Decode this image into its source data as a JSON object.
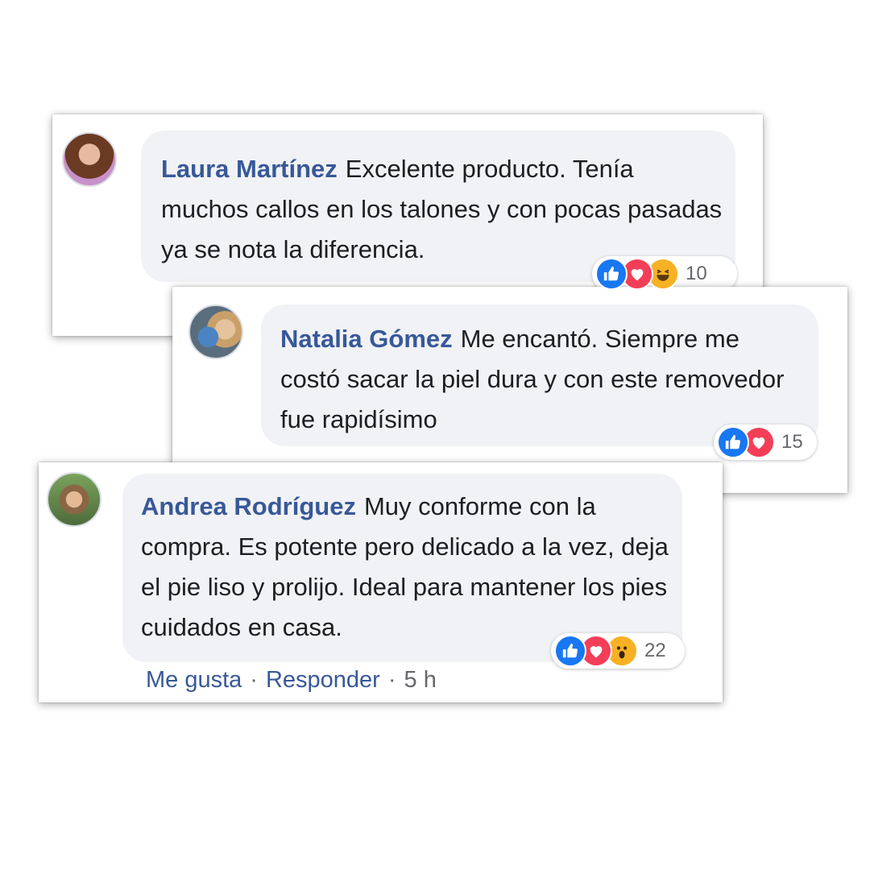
{
  "comments": [
    {
      "name": "Laura Martínez",
      "text": "Excelente producto. Tenía muchos callos en los talones y con pocas pasadas ya se nota la diferencia.",
      "reactions": [
        "like",
        "love",
        "haha"
      ],
      "count": "10"
    },
    {
      "name": "Natalia Gómez",
      "text": "Me encantó. Siempre me costó sacar la piel dura y con este removedor fue rapidísimo",
      "reactions": [
        "like",
        "love"
      ],
      "count": "15"
    },
    {
      "name": "Andrea Rodríguez",
      "text": "Muy conforme con la compra. Es potente pero delicado a la vez, deja el pie liso y prolijo. Ideal para mantener los pies cuidados en casa.",
      "reactions": [
        "like",
        "love",
        "wow"
      ],
      "count": "22"
    }
  ],
  "actions": {
    "like": "Me gusta",
    "reply": "Responder",
    "separator": "·",
    "time": "5 h"
  },
  "colors": {
    "name": "#385898",
    "bubble": "#f0f2f5",
    "like": "#1877f2",
    "love": "#f33e58",
    "emoji": "#f7b125"
  }
}
